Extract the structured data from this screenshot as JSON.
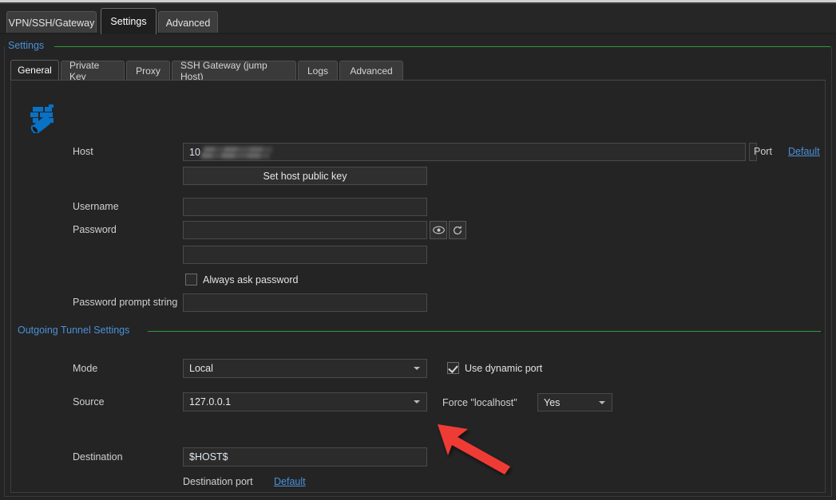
{
  "window": {
    "outer_tabs": [
      {
        "label": "VPN/SSH/Gateway",
        "active": false
      },
      {
        "label": "Settings",
        "active": true
      },
      {
        "label": "Advanced",
        "active": false
      }
    ]
  },
  "settings_group": {
    "title": "Settings",
    "rule_color": "#2e9b3e"
  },
  "inner_tabs": [
    {
      "label": "General",
      "active": true
    },
    {
      "label": "Private Key",
      "active": false
    },
    {
      "label": "Proxy",
      "active": false
    },
    {
      "label": "SSH Gateway (jump Host)",
      "active": false
    },
    {
      "label": "Logs",
      "active": false
    },
    {
      "label": "Advanced",
      "active": false
    }
  ],
  "general": {
    "connection_icon": "firewall-tunnel-icon",
    "host": {
      "label": "Host",
      "value": "10",
      "value_redacted": true,
      "port_label": "Port",
      "port_default_link": "Default"
    },
    "set_host_public_key_button": "Set host public key",
    "username": {
      "label": "Username",
      "value": "",
      "placeholder": ""
    },
    "password": {
      "label": "Password",
      "value": "",
      "reveal_icon": "eye-icon",
      "generate_icon": "refresh-icon",
      "confirm_value": ""
    },
    "always_ask_password": {
      "label": "Always ask password",
      "checked": false
    },
    "password_prompt_string": {
      "label": "Password prompt string",
      "value": ""
    }
  },
  "outgoing_tunnel": {
    "title": "Outgoing Tunnel Settings",
    "mode": {
      "label": "Mode",
      "value": "Local"
    },
    "source": {
      "label": "Source",
      "value": "127.0.0.1"
    },
    "use_dynamic_port": {
      "label": "Use dynamic port",
      "checked": true
    },
    "force_localhost": {
      "label": "Force \"localhost\"",
      "value": "Yes"
    },
    "destination": {
      "label": "Destination",
      "value": "$HOST$"
    },
    "destination_port": {
      "label": "Destination port",
      "default_link": "Default"
    }
  },
  "annotation": {
    "arrow_color": "#ef3b36",
    "points_to": "destination-input"
  }
}
